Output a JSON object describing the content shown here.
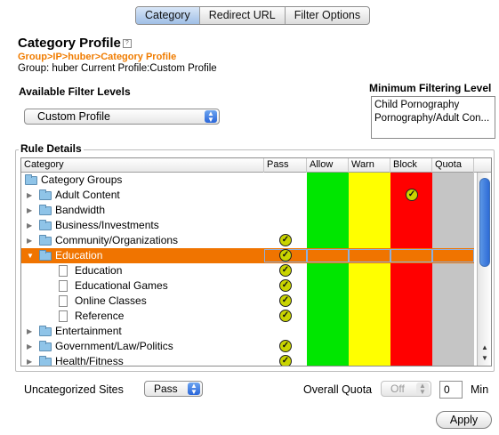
{
  "tabs": [
    {
      "label": "Category",
      "active": true
    },
    {
      "label": "Redirect URL",
      "active": false
    },
    {
      "label": "Filter Options",
      "active": false
    }
  ],
  "title": "Category Profile",
  "info_icon": "info-icon",
  "breadcrumb": "Group>IP>huber>Category Profile",
  "group_line": "Group: huber   Current Profile:Custom Profile",
  "available_filter": {
    "label": "Available Filter Levels",
    "selected": "Custom Profile"
  },
  "minimum_filtering": {
    "label": "Minimum Filtering Level",
    "items": [
      "Child Pornography",
      "Pornography/Adult Con..."
    ]
  },
  "rule_details": {
    "label": "Rule Details",
    "columns": [
      "Category",
      "Pass",
      "Allow",
      "Warn",
      "Block",
      "Quota"
    ],
    "colors": {
      "allow": "#00e600",
      "warn": "#ffff00",
      "block": "#ff0000",
      "quota": "#c5c5c5",
      "selected_row": "#f07400"
    },
    "rows": [
      {
        "label": "Category Groups",
        "level": 0,
        "type": "folder",
        "expanded": "none",
        "check": ""
      },
      {
        "label": "Adult Content",
        "level": 1,
        "type": "folder",
        "expanded": "collapsed",
        "check": "block"
      },
      {
        "label": "Bandwidth",
        "level": 1,
        "type": "folder",
        "expanded": "collapsed",
        "check": ""
      },
      {
        "label": "Business/Investments",
        "level": 1,
        "type": "folder",
        "expanded": "collapsed",
        "check": ""
      },
      {
        "label": "Community/Organizations",
        "level": 1,
        "type": "folder",
        "expanded": "collapsed",
        "check": "pass"
      },
      {
        "label": "Education",
        "level": 1,
        "type": "folder",
        "expanded": "expanded",
        "check": "pass",
        "selected": true
      },
      {
        "label": "Education",
        "level": 2,
        "type": "doc",
        "expanded": "none",
        "check": "pass"
      },
      {
        "label": "Educational Games",
        "level": 2,
        "type": "doc",
        "expanded": "none",
        "check": "pass"
      },
      {
        "label": "Online Classes",
        "level": 2,
        "type": "doc",
        "expanded": "none",
        "check": "pass"
      },
      {
        "label": "Reference",
        "level": 2,
        "type": "doc",
        "expanded": "none",
        "check": "pass"
      },
      {
        "label": "Entertainment",
        "level": 1,
        "type": "folder",
        "expanded": "collapsed",
        "check": ""
      },
      {
        "label": "Government/Law/Politics",
        "level": 1,
        "type": "folder",
        "expanded": "collapsed",
        "check": "pass"
      },
      {
        "label": "Health/Fitness",
        "level": 1,
        "type": "folder",
        "expanded": "collapsed",
        "check": "pass"
      }
    ]
  },
  "uncategorized": {
    "label": "Uncategorized Sites",
    "value": "Pass"
  },
  "overall_quota": {
    "label": "Overall Quota",
    "value": "Off",
    "amount": "0",
    "unit": "Min"
  },
  "apply_label": "Apply"
}
